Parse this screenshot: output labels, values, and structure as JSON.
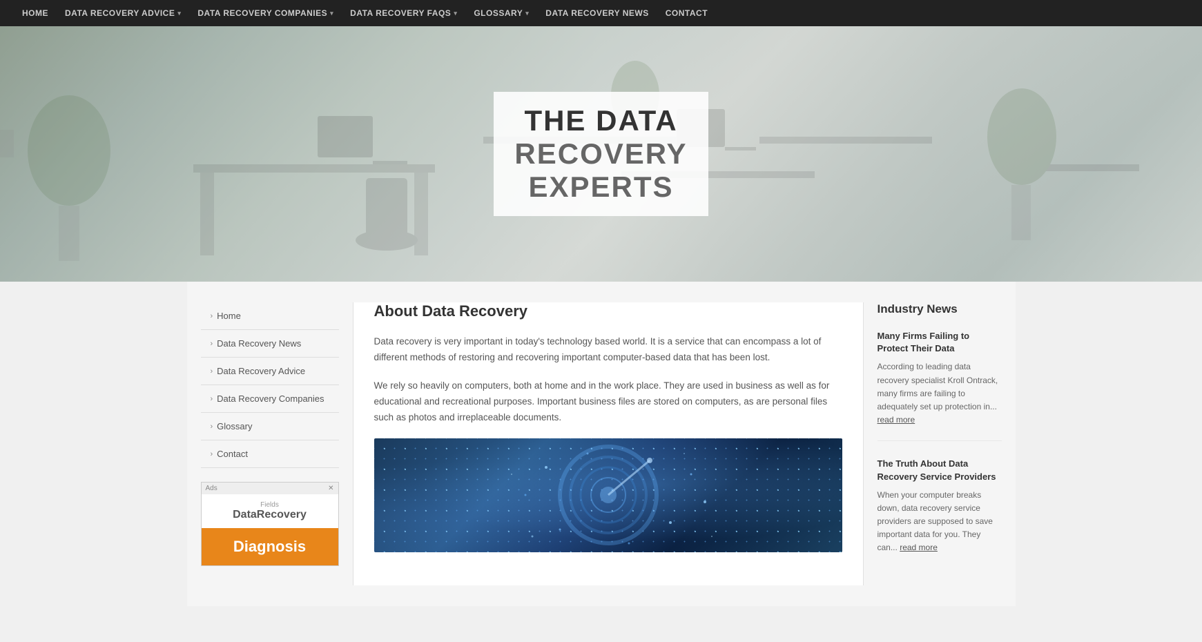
{
  "nav": {
    "items": [
      {
        "label": "HOME",
        "hasDropdown": false
      },
      {
        "label": "DATA RECOVERY ADVICE",
        "hasDropdown": true
      },
      {
        "label": "DATA RECOVERY COMPANIES",
        "hasDropdown": true
      },
      {
        "label": "DATA RECOVERY FAQS",
        "hasDropdown": true
      },
      {
        "label": "GLOSSARY",
        "hasDropdown": true
      },
      {
        "label": "DATA RECOVERY NEWS",
        "hasDropdown": false
      },
      {
        "label": "CONTACT",
        "hasDropdown": false
      }
    ]
  },
  "hero": {
    "line1": "THE DATA",
    "line2": "RECOVERY",
    "line3": "EXPERTS"
  },
  "sidebar": {
    "items": [
      {
        "label": "Home"
      },
      {
        "label": "Data Recovery News"
      },
      {
        "label": "Data Recovery Advice"
      },
      {
        "label": "Data Recovery Companies"
      },
      {
        "label": "Glossary"
      },
      {
        "label": "Contact"
      }
    ],
    "ad": {
      "adLabel": "Ads",
      "closeLabel": "✕",
      "brand": "DataRecovery",
      "brandSuffix": "Fields",
      "cta": "Diagnosis"
    }
  },
  "main": {
    "title": "About Data Recovery",
    "para1": "Data recovery is very important in today's technology based world. It is a service that can encompass a lot of different methods of restoring and recovering important computer-based data that has been lost.",
    "para2": "We rely so heavily on computers, both at home and in the work place. They are used in business as well as for educational and recreational purposes. Important business files are stored on computers, as are personal files such as photos and irreplaceable documents."
  },
  "industryNews": {
    "heading": "Industry News",
    "items": [
      {
        "title": "Many Firms Failing to Protect Their Data",
        "excerpt": "According to leading data recovery specialist Kroll Ontrack, many firms are failing to adequately set up protection in...",
        "readMoreLabel": "read more"
      },
      {
        "title": "The Truth About Data Recovery Service Providers",
        "excerpt": "When your computer breaks down, data recovery service providers are supposed to save important data for you. They can...",
        "readMoreLabel": "read more"
      }
    ]
  }
}
